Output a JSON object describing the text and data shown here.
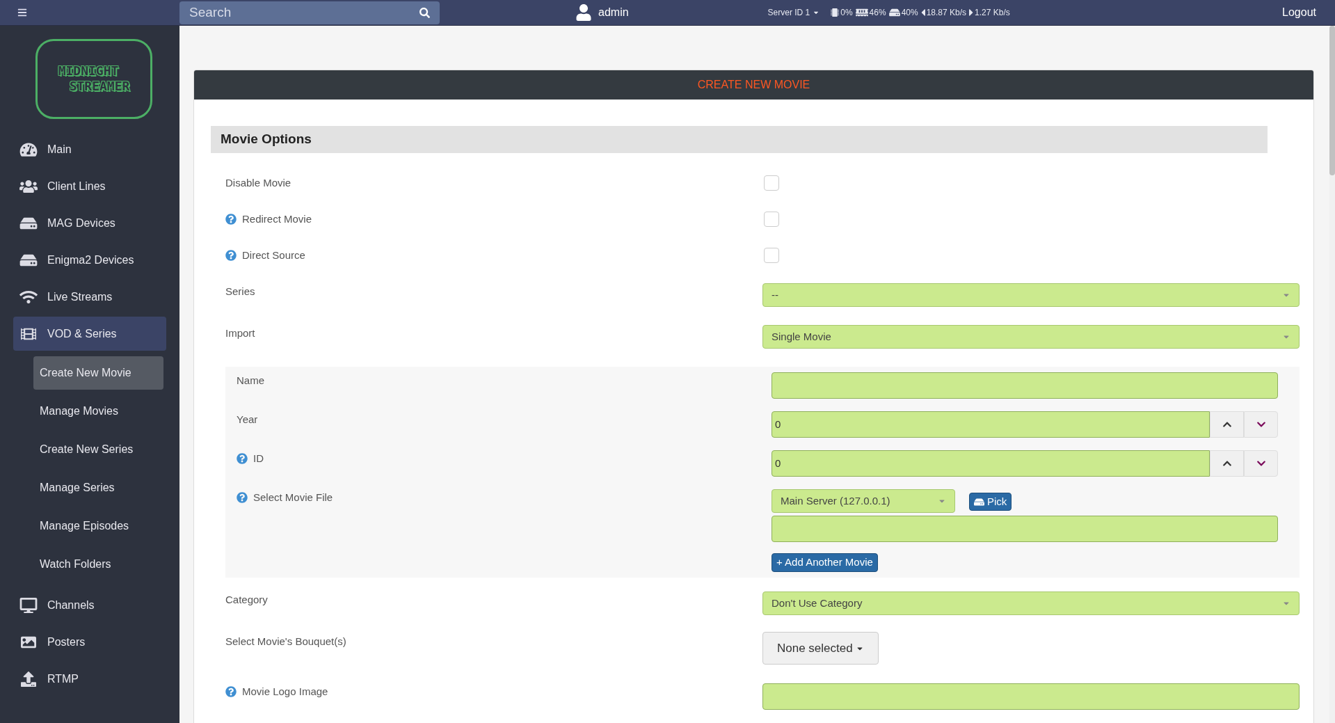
{
  "topbar": {
    "search": {
      "placeholder": "Search"
    },
    "user": "admin",
    "server": "Server ID 1",
    "cpu": "0%",
    "ram": "46%",
    "disk": "40%",
    "download": "18.87 Kb/s",
    "upload": "1.27 Kb/s",
    "logout": "Logout"
  },
  "logo": {
    "line1": "MIDNIGHT",
    "line2": "STREAMER"
  },
  "sidebar": {
    "items": [
      {
        "label": "Main",
        "selected": false
      },
      {
        "label": "Client Lines",
        "selected": false
      },
      {
        "label": "MAG Devices",
        "selected": false
      },
      {
        "label": "Enigma2 Devices",
        "selected": false
      },
      {
        "label": "Live Streams",
        "selected": false
      },
      {
        "label": "VOD & Series",
        "selected": true,
        "children": [
          {
            "label": "Create New Movie",
            "selected": true
          },
          {
            "label": "Manage Movies",
            "selected": false
          },
          {
            "label": "Create New Series",
            "selected": false
          },
          {
            "label": "Manage Series",
            "selected": false
          },
          {
            "label": "Manage Episodes",
            "selected": false
          },
          {
            "label": "Watch Folders",
            "selected": false
          }
        ]
      },
      {
        "label": "Channels",
        "selected": false
      },
      {
        "label": "Posters",
        "selected": false
      },
      {
        "label": "RTMP",
        "selected": false
      }
    ]
  },
  "card": {
    "title": "CREATE NEW MOVIE",
    "section": "Movie Options",
    "rows": [
      {
        "kind": "checkbox",
        "label": "Disable Movie",
        "help": false,
        "checked": false
      },
      {
        "kind": "checkbox",
        "label": "Redirect Movie",
        "help": true,
        "checked": false
      },
      {
        "kind": "checkbox",
        "label": "Direct Source",
        "help": true,
        "checked": false
      },
      {
        "kind": "select",
        "label": "Series",
        "help": false,
        "value": "--"
      },
      {
        "kind": "select",
        "label": "Import",
        "help": false,
        "value": "Single Movie"
      },
      {
        "kind": "group",
        "rows": [
          {
            "kind": "text",
            "label": "Name",
            "help": false
          },
          {
            "kind": "number",
            "label": "Year",
            "help": false,
            "value": "0"
          },
          {
            "kind": "number",
            "label": "ID",
            "help": true,
            "value": "0"
          },
          {
            "kind": "file",
            "label": "Select Movie File",
            "help": true,
            "server": "Main Server (127.0.0.1)",
            "pick": "Pick",
            "add": "+ Add Another Movie"
          }
        ]
      },
      {
        "kind": "select",
        "label": "Category",
        "help": false,
        "value": "Don't Use Category"
      },
      {
        "kind": "multiselect",
        "label": "Select Movie's Bouquet(s)",
        "help": false,
        "value": "None selected"
      },
      {
        "kind": "text",
        "label": "Movie Logo Image",
        "help": true
      }
    ]
  }
}
